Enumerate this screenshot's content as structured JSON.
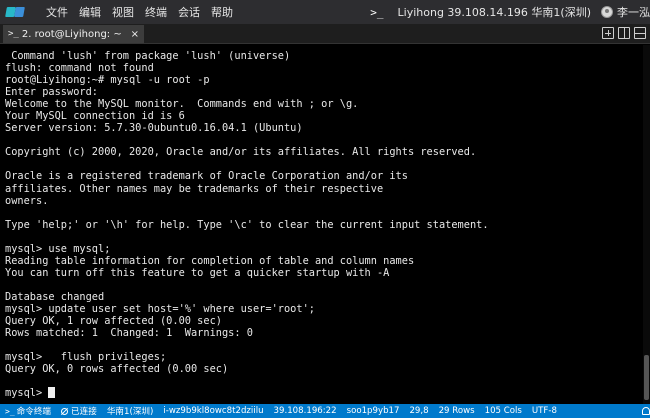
{
  "menubar": {
    "items": [
      "文件",
      "编辑",
      "视图",
      "终端",
      "会话",
      "帮助"
    ],
    "terminal_icon": ">_",
    "session_info": "Liyihong 39.108.14.196 华南1(深圳)",
    "user_name": "李一泓"
  },
  "tab": {
    "icon": ">_",
    "label": "2. root@Liyihong: ~",
    "close": "×"
  },
  "terminal": {
    "lines": [
      " Command 'lush' from package 'lush' (universe)",
      "flush: command not found",
      "root@Liyihong:~# mysql -u root -p",
      "Enter password:",
      "Welcome to the MySQL monitor.  Commands end with ; or \\g.",
      "Your MySQL connection id is 6",
      "Server version: 5.7.30-0ubuntu0.16.04.1 (Ubuntu)",
      "",
      "Copyright (c) 2000, 2020, Oracle and/or its affiliates. All rights reserved.",
      "",
      "Oracle is a registered trademark of Oracle Corporation and/or its",
      "affiliates. Other names may be trademarks of their respective",
      "owners.",
      "",
      "Type 'help;' or '\\h' for help. Type '\\c' to clear the current input statement.",
      "",
      "mysql> use mysql;",
      "Reading table information for completion of table and column names",
      "You can turn off this feature to get a quicker startup with -A",
      "",
      "Database changed",
      "mysql> update user set host='%' where user='root';",
      "Query OK, 1 row affected (0.00 sec)",
      "Rows matched: 1  Changed: 1  Warnings: 0",
      "",
      "mysql>   flush privileges;",
      "Query OK, 0 rows affected (0.00 sec)",
      ""
    ],
    "prompt": "mysql> "
  },
  "statusbar": {
    "terminal_label": "命令终端",
    "connection_status": "已连接",
    "region": "华南1(深圳)",
    "instance_id": "i-wz9b9kl8owc8t2dziilu",
    "ip": "39.108.196:22",
    "hostname": "soo1p9yb17",
    "cursor_pos": "29,8",
    "rows": "29 Rows",
    "cols": "105 Cols",
    "encoding": "UTF-8"
  }
}
